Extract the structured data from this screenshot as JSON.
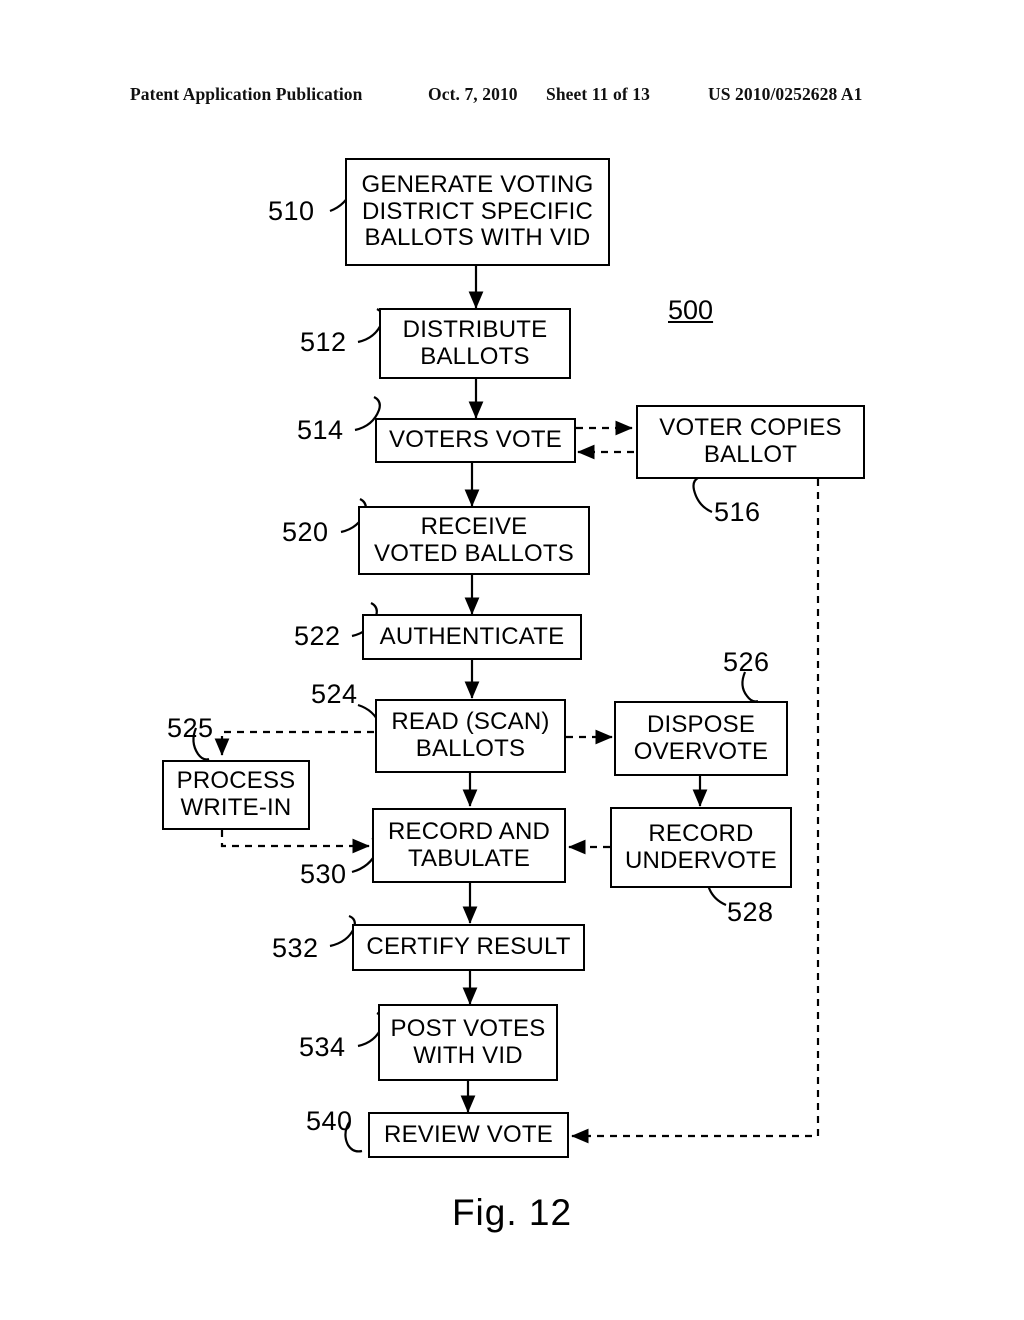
{
  "header": {
    "publication": "Patent Application Publication",
    "date": "Oct. 7, 2010",
    "sheet": "Sheet 11 of 13",
    "patent_number": "US 2010/0252628 A1"
  },
  "figure": {
    "caption": "Fig. 12",
    "figure_reference": "500",
    "boxes": [
      {
        "id": "510",
        "label": "GENERATE VOTING\nDISTRICT SPECIFIC\nBALLOTS WITH VID"
      },
      {
        "id": "512",
        "label": "DISTRIBUTE\nBALLOTS"
      },
      {
        "id": "514",
        "label": "VOTERS VOTE"
      },
      {
        "id": "516",
        "label": "VOTER COPIES\nBALLOT"
      },
      {
        "id": "520",
        "label": "RECEIVE\nVOTED BALLOTS"
      },
      {
        "id": "522",
        "label": "AUTHENTICATE"
      },
      {
        "id": "524",
        "label": "READ (SCAN)\nBALLOTS"
      },
      {
        "id": "525",
        "label": "PROCESS\nWRITE-IN"
      },
      {
        "id": "526",
        "label": "DISPOSE\nOVERVOTE"
      },
      {
        "id": "528",
        "label": "RECORD\nUNDERVOTE"
      },
      {
        "id": "530",
        "label": "RECORD AND\nTABULATE"
      },
      {
        "id": "532",
        "label": "CERTIFY RESULT"
      },
      {
        "id": "534",
        "label": "POST VOTES\nWITH VID"
      },
      {
        "id": "540",
        "label": "REVIEW VOTE"
      }
    ],
    "reference_numerals": [
      {
        "value": "510"
      },
      {
        "value": "512"
      },
      {
        "value": "514"
      },
      {
        "value": "516"
      },
      {
        "value": "520"
      },
      {
        "value": "522"
      },
      {
        "value": "524"
      },
      {
        "value": "525"
      },
      {
        "value": "526"
      },
      {
        "value": "528"
      },
      {
        "value": "530"
      },
      {
        "value": "532"
      },
      {
        "value": "534"
      },
      {
        "value": "540"
      }
    ]
  },
  "colors": {
    "ink": "#000000",
    "paper": "#ffffff"
  }
}
